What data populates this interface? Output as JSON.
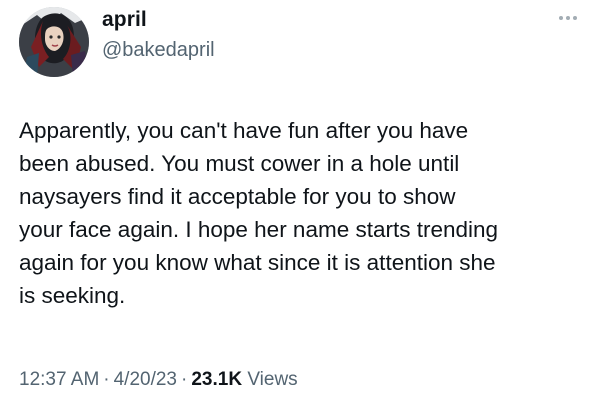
{
  "user": {
    "display_name": "april",
    "handle": "@bakedapril",
    "avatar_icon": "profile-avatar"
  },
  "menu": {
    "more_icon": "more-horizontal-icon"
  },
  "tweet": {
    "text": "Apparently, you can't have fun after you have\nbeen abused. You must cower in a hole until\nnaysayers find it acceptable for you to show\nyour face again. I hope her name starts trending\nagain for you know what since it is attention she\nis seeking."
  },
  "meta": {
    "time": "12:37 AM",
    "separator": "·",
    "date": "4/20/23",
    "views_count": "23.1K",
    "views_label": "Views"
  },
  "colors": {
    "text": "#0f1419",
    "secondary": "#536471",
    "background": "#ffffff"
  }
}
